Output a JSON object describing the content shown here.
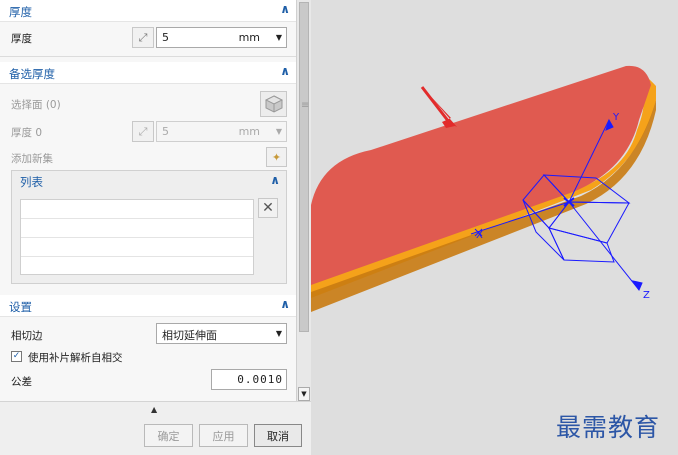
{
  "thickness_section": {
    "title": "厚度",
    "field_label": "厚度",
    "value": "5",
    "unit": "mm"
  },
  "alt_thickness_section": {
    "title": "备选厚度",
    "select_face_label": "选择面 (0)",
    "thickness0_label": "厚度 0",
    "thickness0_value": "5",
    "thickness0_unit": "mm",
    "add_set_label": "添加新集",
    "list": {
      "title": "列表",
      "rows": [
        "",
        "",
        "",
        ""
      ]
    }
  },
  "settings_section": {
    "title": "设置",
    "tangent_edge_label": "相切边",
    "tangent_edge_value": "相切延伸面",
    "checkbox_label": "使用补片解析自相交",
    "checkbox_checked": true,
    "tolerance_label": "公差",
    "tolerance_value": "0.0010"
  },
  "buttons": {
    "ok": "确定",
    "apply": "应用",
    "cancel": "取消"
  },
  "viewport": {
    "axis_labels": {
      "x": "X",
      "y": "Y",
      "z": "Z"
    },
    "face_color": "#e05a50",
    "edge_color": "#f5a21a",
    "axis_color": "#1a1aff",
    "arrow_color": "#e22b2b"
  },
  "watermark": "最需教育"
}
